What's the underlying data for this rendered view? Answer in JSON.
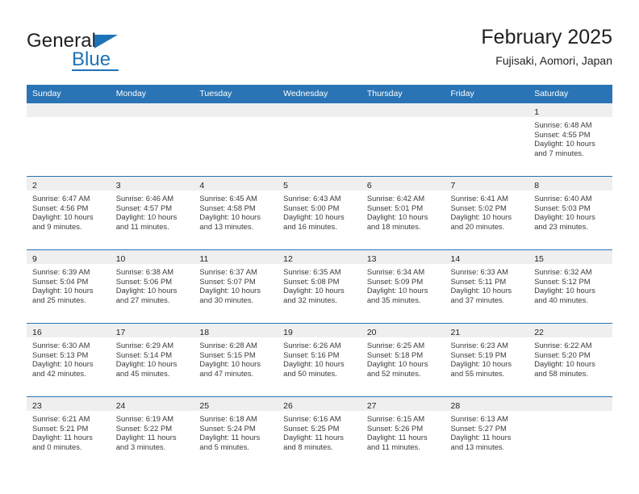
{
  "brand": {
    "name_part1": "General",
    "name_part2": "Blue",
    "triangle_color": "#1e72b8"
  },
  "header": {
    "month_title": "February 2025",
    "location": "Fujisaki, Aomori, Japan"
  },
  "theme": {
    "header_bg": "#2a74b5",
    "header_text": "#ffffff",
    "daynum_band": "#efefef",
    "row_divider": "#2a74b5",
    "body_text": "#3b3b3b"
  },
  "weekday_headers": [
    "Sunday",
    "Monday",
    "Tuesday",
    "Wednesday",
    "Thursday",
    "Friday",
    "Saturday"
  ],
  "calendar": {
    "weeks": [
      [
        {
          "blank": true
        },
        {
          "blank": true
        },
        {
          "blank": true
        },
        {
          "blank": true
        },
        {
          "blank": true
        },
        {
          "blank": true
        },
        {
          "day": "1",
          "sunrise": "Sunrise: 6:48 AM",
          "sunset": "Sunset: 4:55 PM",
          "daylight1": "Daylight: 10 hours",
          "daylight2": "and 7 minutes."
        }
      ],
      [
        {
          "day": "2",
          "sunrise": "Sunrise: 6:47 AM",
          "sunset": "Sunset: 4:56 PM",
          "daylight1": "Daylight: 10 hours",
          "daylight2": "and 9 minutes."
        },
        {
          "day": "3",
          "sunrise": "Sunrise: 6:46 AM",
          "sunset": "Sunset: 4:57 PM",
          "daylight1": "Daylight: 10 hours",
          "daylight2": "and 11 minutes."
        },
        {
          "day": "4",
          "sunrise": "Sunrise: 6:45 AM",
          "sunset": "Sunset: 4:58 PM",
          "daylight1": "Daylight: 10 hours",
          "daylight2": "and 13 minutes."
        },
        {
          "day": "5",
          "sunrise": "Sunrise: 6:43 AM",
          "sunset": "Sunset: 5:00 PM",
          "daylight1": "Daylight: 10 hours",
          "daylight2": "and 16 minutes."
        },
        {
          "day": "6",
          "sunrise": "Sunrise: 6:42 AM",
          "sunset": "Sunset: 5:01 PM",
          "daylight1": "Daylight: 10 hours",
          "daylight2": "and 18 minutes."
        },
        {
          "day": "7",
          "sunrise": "Sunrise: 6:41 AM",
          "sunset": "Sunset: 5:02 PM",
          "daylight1": "Daylight: 10 hours",
          "daylight2": "and 20 minutes."
        },
        {
          "day": "8",
          "sunrise": "Sunrise: 6:40 AM",
          "sunset": "Sunset: 5:03 PM",
          "daylight1": "Daylight: 10 hours",
          "daylight2": "and 23 minutes."
        }
      ],
      [
        {
          "day": "9",
          "sunrise": "Sunrise: 6:39 AM",
          "sunset": "Sunset: 5:04 PM",
          "daylight1": "Daylight: 10 hours",
          "daylight2": "and 25 minutes."
        },
        {
          "day": "10",
          "sunrise": "Sunrise: 6:38 AM",
          "sunset": "Sunset: 5:06 PM",
          "daylight1": "Daylight: 10 hours",
          "daylight2": "and 27 minutes."
        },
        {
          "day": "11",
          "sunrise": "Sunrise: 6:37 AM",
          "sunset": "Sunset: 5:07 PM",
          "daylight1": "Daylight: 10 hours",
          "daylight2": "and 30 minutes."
        },
        {
          "day": "12",
          "sunrise": "Sunrise: 6:35 AM",
          "sunset": "Sunset: 5:08 PM",
          "daylight1": "Daylight: 10 hours",
          "daylight2": "and 32 minutes."
        },
        {
          "day": "13",
          "sunrise": "Sunrise: 6:34 AM",
          "sunset": "Sunset: 5:09 PM",
          "daylight1": "Daylight: 10 hours",
          "daylight2": "and 35 minutes."
        },
        {
          "day": "14",
          "sunrise": "Sunrise: 6:33 AM",
          "sunset": "Sunset: 5:11 PM",
          "daylight1": "Daylight: 10 hours",
          "daylight2": "and 37 minutes."
        },
        {
          "day": "15",
          "sunrise": "Sunrise: 6:32 AM",
          "sunset": "Sunset: 5:12 PM",
          "daylight1": "Daylight: 10 hours",
          "daylight2": "and 40 minutes."
        }
      ],
      [
        {
          "day": "16",
          "sunrise": "Sunrise: 6:30 AM",
          "sunset": "Sunset: 5:13 PM",
          "daylight1": "Daylight: 10 hours",
          "daylight2": "and 42 minutes."
        },
        {
          "day": "17",
          "sunrise": "Sunrise: 6:29 AM",
          "sunset": "Sunset: 5:14 PM",
          "daylight1": "Daylight: 10 hours",
          "daylight2": "and 45 minutes."
        },
        {
          "day": "18",
          "sunrise": "Sunrise: 6:28 AM",
          "sunset": "Sunset: 5:15 PM",
          "daylight1": "Daylight: 10 hours",
          "daylight2": "and 47 minutes."
        },
        {
          "day": "19",
          "sunrise": "Sunrise: 6:26 AM",
          "sunset": "Sunset: 5:16 PM",
          "daylight1": "Daylight: 10 hours",
          "daylight2": "and 50 minutes."
        },
        {
          "day": "20",
          "sunrise": "Sunrise: 6:25 AM",
          "sunset": "Sunset: 5:18 PM",
          "daylight1": "Daylight: 10 hours",
          "daylight2": "and 52 minutes."
        },
        {
          "day": "21",
          "sunrise": "Sunrise: 6:23 AM",
          "sunset": "Sunset: 5:19 PM",
          "daylight1": "Daylight: 10 hours",
          "daylight2": "and 55 minutes."
        },
        {
          "day": "22",
          "sunrise": "Sunrise: 6:22 AM",
          "sunset": "Sunset: 5:20 PM",
          "daylight1": "Daylight: 10 hours",
          "daylight2": "and 58 minutes."
        }
      ],
      [
        {
          "day": "23",
          "sunrise": "Sunrise: 6:21 AM",
          "sunset": "Sunset: 5:21 PM",
          "daylight1": "Daylight: 11 hours",
          "daylight2": "and 0 minutes."
        },
        {
          "day": "24",
          "sunrise": "Sunrise: 6:19 AM",
          "sunset": "Sunset: 5:22 PM",
          "daylight1": "Daylight: 11 hours",
          "daylight2": "and 3 minutes."
        },
        {
          "day": "25",
          "sunrise": "Sunrise: 6:18 AM",
          "sunset": "Sunset: 5:24 PM",
          "daylight1": "Daylight: 11 hours",
          "daylight2": "and 5 minutes."
        },
        {
          "day": "26",
          "sunrise": "Sunrise: 6:16 AM",
          "sunset": "Sunset: 5:25 PM",
          "daylight1": "Daylight: 11 hours",
          "daylight2": "and 8 minutes."
        },
        {
          "day": "27",
          "sunrise": "Sunrise: 6:15 AM",
          "sunset": "Sunset: 5:26 PM",
          "daylight1": "Daylight: 11 hours",
          "daylight2": "and 11 minutes."
        },
        {
          "day": "28",
          "sunrise": "Sunrise: 6:13 AM",
          "sunset": "Sunset: 5:27 PM",
          "daylight1": "Daylight: 11 hours",
          "daylight2": "and 13 minutes."
        },
        {
          "blank": true
        }
      ]
    ]
  }
}
